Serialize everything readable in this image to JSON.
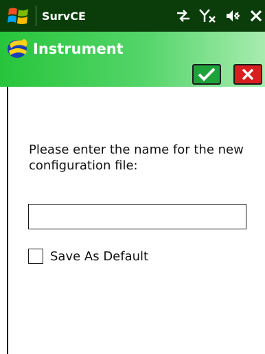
{
  "statusbar": {
    "app_name": "SurvCE",
    "icons": [
      "windows-start-icon",
      "connectivity-icon",
      "no-signal-icon",
      "volume-muted-icon",
      "close-icon"
    ],
    "background": "#0a3d0a"
  },
  "header": {
    "title": "Instrument",
    "logo_icon": "carlson-logo-icon",
    "ok_icon": "checkmark-icon",
    "cancel_icon": "x-icon",
    "ok_color": "#1ea23a",
    "cancel_color": "#d81e1e",
    "gradient_start": "#27c53b",
    "gradient_end": "#a8ecb0"
  },
  "form": {
    "prompt_line1": "Please enter the name for the new",
    "prompt_line2": "configuration file:",
    "name_value": "",
    "save_default_label": "Save As Default",
    "save_default_checked": false
  }
}
